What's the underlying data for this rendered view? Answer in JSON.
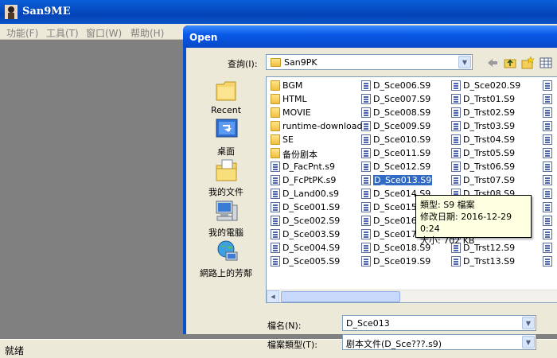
{
  "app": {
    "title": "San9ME",
    "menu": [
      "功能(F)",
      "工具(T)",
      "窗口(W)",
      "帮助(H)"
    ],
    "status": "就绪"
  },
  "dialog": {
    "title": "Open",
    "look_in_label": "查詢(I):",
    "look_in_value": "San9PK",
    "places": [
      "Recent",
      "桌面",
      "我的文件",
      "我的電腦",
      "網路上的芳鄰"
    ],
    "filename_label": "檔名(N):",
    "filename_value": "D_Sce013",
    "filetype_label": "檔案類型(T):",
    "filetype_value": "剧本文件(D_Sce???.s9)"
  },
  "files": {
    "col1": [
      {
        "name": "BGM",
        "type": "folder"
      },
      {
        "name": "HTML",
        "type": "folder"
      },
      {
        "name": "MOVIE",
        "type": "folder"
      },
      {
        "name": "runtime-download",
        "type": "folder"
      },
      {
        "name": "SE",
        "type": "folder"
      },
      {
        "name": "备份剧本",
        "type": "folder"
      },
      {
        "name": "D_FacPnt.s9",
        "type": "s9"
      },
      {
        "name": "D_FcPtPK.s9",
        "type": "s9"
      },
      {
        "name": "D_Land00.s9",
        "type": "s9"
      },
      {
        "name": "D_Sce001.S9",
        "type": "s9"
      },
      {
        "name": "D_Sce002.S9",
        "type": "s9"
      },
      {
        "name": "D_Sce003.S9",
        "type": "s9"
      },
      {
        "name": "D_Sce004.S9",
        "type": "s9"
      },
      {
        "name": "D_Sce005.S9",
        "type": "s9"
      }
    ],
    "col2": [
      {
        "name": "D_Sce006.S9",
        "type": "s9"
      },
      {
        "name": "D_Sce007.S9",
        "type": "s9"
      },
      {
        "name": "D_Sce008.S9",
        "type": "s9"
      },
      {
        "name": "D_Sce009.S9",
        "type": "s9"
      },
      {
        "name": "D_Sce010.S9",
        "type": "s9"
      },
      {
        "name": "D_Sce011.S9",
        "type": "s9"
      },
      {
        "name": "D_Sce012.S9",
        "type": "s9"
      },
      {
        "name": "D_Sce013.S9",
        "type": "s9",
        "selected": true
      },
      {
        "name": "D_Sce014.S9",
        "type": "s9"
      },
      {
        "name": "D_Sce015.S9",
        "type": "s9"
      },
      {
        "name": "D_Sce016.S9",
        "type": "s9"
      },
      {
        "name": "D_Sce017.S9",
        "type": "s9"
      },
      {
        "name": "D_Sce018.S9",
        "type": "s9"
      },
      {
        "name": "D_Sce019.S9",
        "type": "s9"
      }
    ],
    "col3": [
      {
        "name": "D_Sce020.S9",
        "type": "s9"
      },
      {
        "name": "D_Trst01.S9",
        "type": "s9"
      },
      {
        "name": "D_Trst02.S9",
        "type": "s9"
      },
      {
        "name": "D_Trst03.S9",
        "type": "s9"
      },
      {
        "name": "D_Trst04.S9",
        "type": "s9"
      },
      {
        "name": "D_Trst05.S9",
        "type": "s9"
      },
      {
        "name": "D_Trst06.S9",
        "type": "s9"
      },
      {
        "name": "D_Trst07.S9",
        "type": "s9"
      },
      {
        "name": "D_Trst08.S9",
        "type": "s9"
      },
      {
        "name": "",
        "type": "s9"
      },
      {
        "name": "",
        "type": "s9"
      },
      {
        "name": "",
        "type": "s9"
      },
      {
        "name": "D_Trst12.S9",
        "type": "s9"
      },
      {
        "name": "D_Trst13.S9",
        "type": "s9"
      }
    ]
  },
  "tooltip": {
    "type_line": "類型: S9 檔案",
    "date_line": "修改日期: 2016-12-29 0:24",
    "size_line": "大小: 702 KB"
  }
}
